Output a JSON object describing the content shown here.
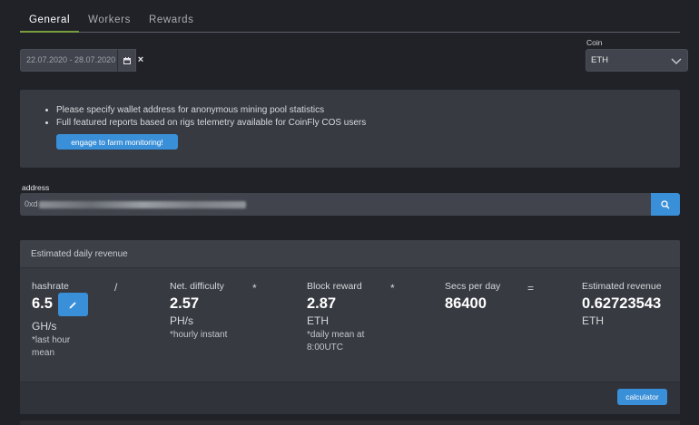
{
  "tabs": [
    {
      "label": "General",
      "active": true
    },
    {
      "label": "Workers",
      "active": false
    },
    {
      "label": "Rewards",
      "active": false
    }
  ],
  "filters": {
    "date_range": "22.07.2020 - 28.07.2020",
    "clear_symbol": "×",
    "coin_label": "Coin",
    "coin_value": "ETH"
  },
  "info": {
    "bullets": [
      "Please specify wallet address for anonymous mining pool statistics",
      "Full featured reports based on rigs telemetry available for CoinFly COS users"
    ],
    "engage_button": "engage to farm monitoring!"
  },
  "address": {
    "label": "address",
    "value_prefix": "0xd"
  },
  "revenue": {
    "title": "Estimated daily revenue",
    "hashrate": {
      "label": "hashrate",
      "value": "6.5",
      "unit": "GH/s",
      "note": "*last hour mean"
    },
    "difficulty": {
      "label": "Net. difficulty",
      "value": "2.57",
      "unit": "PH/s",
      "note": "*hourly instant"
    },
    "block_reward": {
      "label": "Block reward",
      "value": "2.87",
      "unit": "ETH",
      "note": "*daily mean at 8:00UTC"
    },
    "secs_per_day": {
      "label": "Secs per day",
      "value": "86400"
    },
    "estimated": {
      "label": "Estimated revenue",
      "value": "0.62723543",
      "unit": "ETH"
    },
    "operators": {
      "divide": "/",
      "multiply1": "*",
      "multiply2": "*",
      "equals": "="
    },
    "calculator_button": "calculator"
  },
  "colors": {
    "background": "#202228",
    "panel": "#373a41",
    "accent_blue": "#3a8fd9",
    "tab_underline": "#7a9c3e"
  }
}
